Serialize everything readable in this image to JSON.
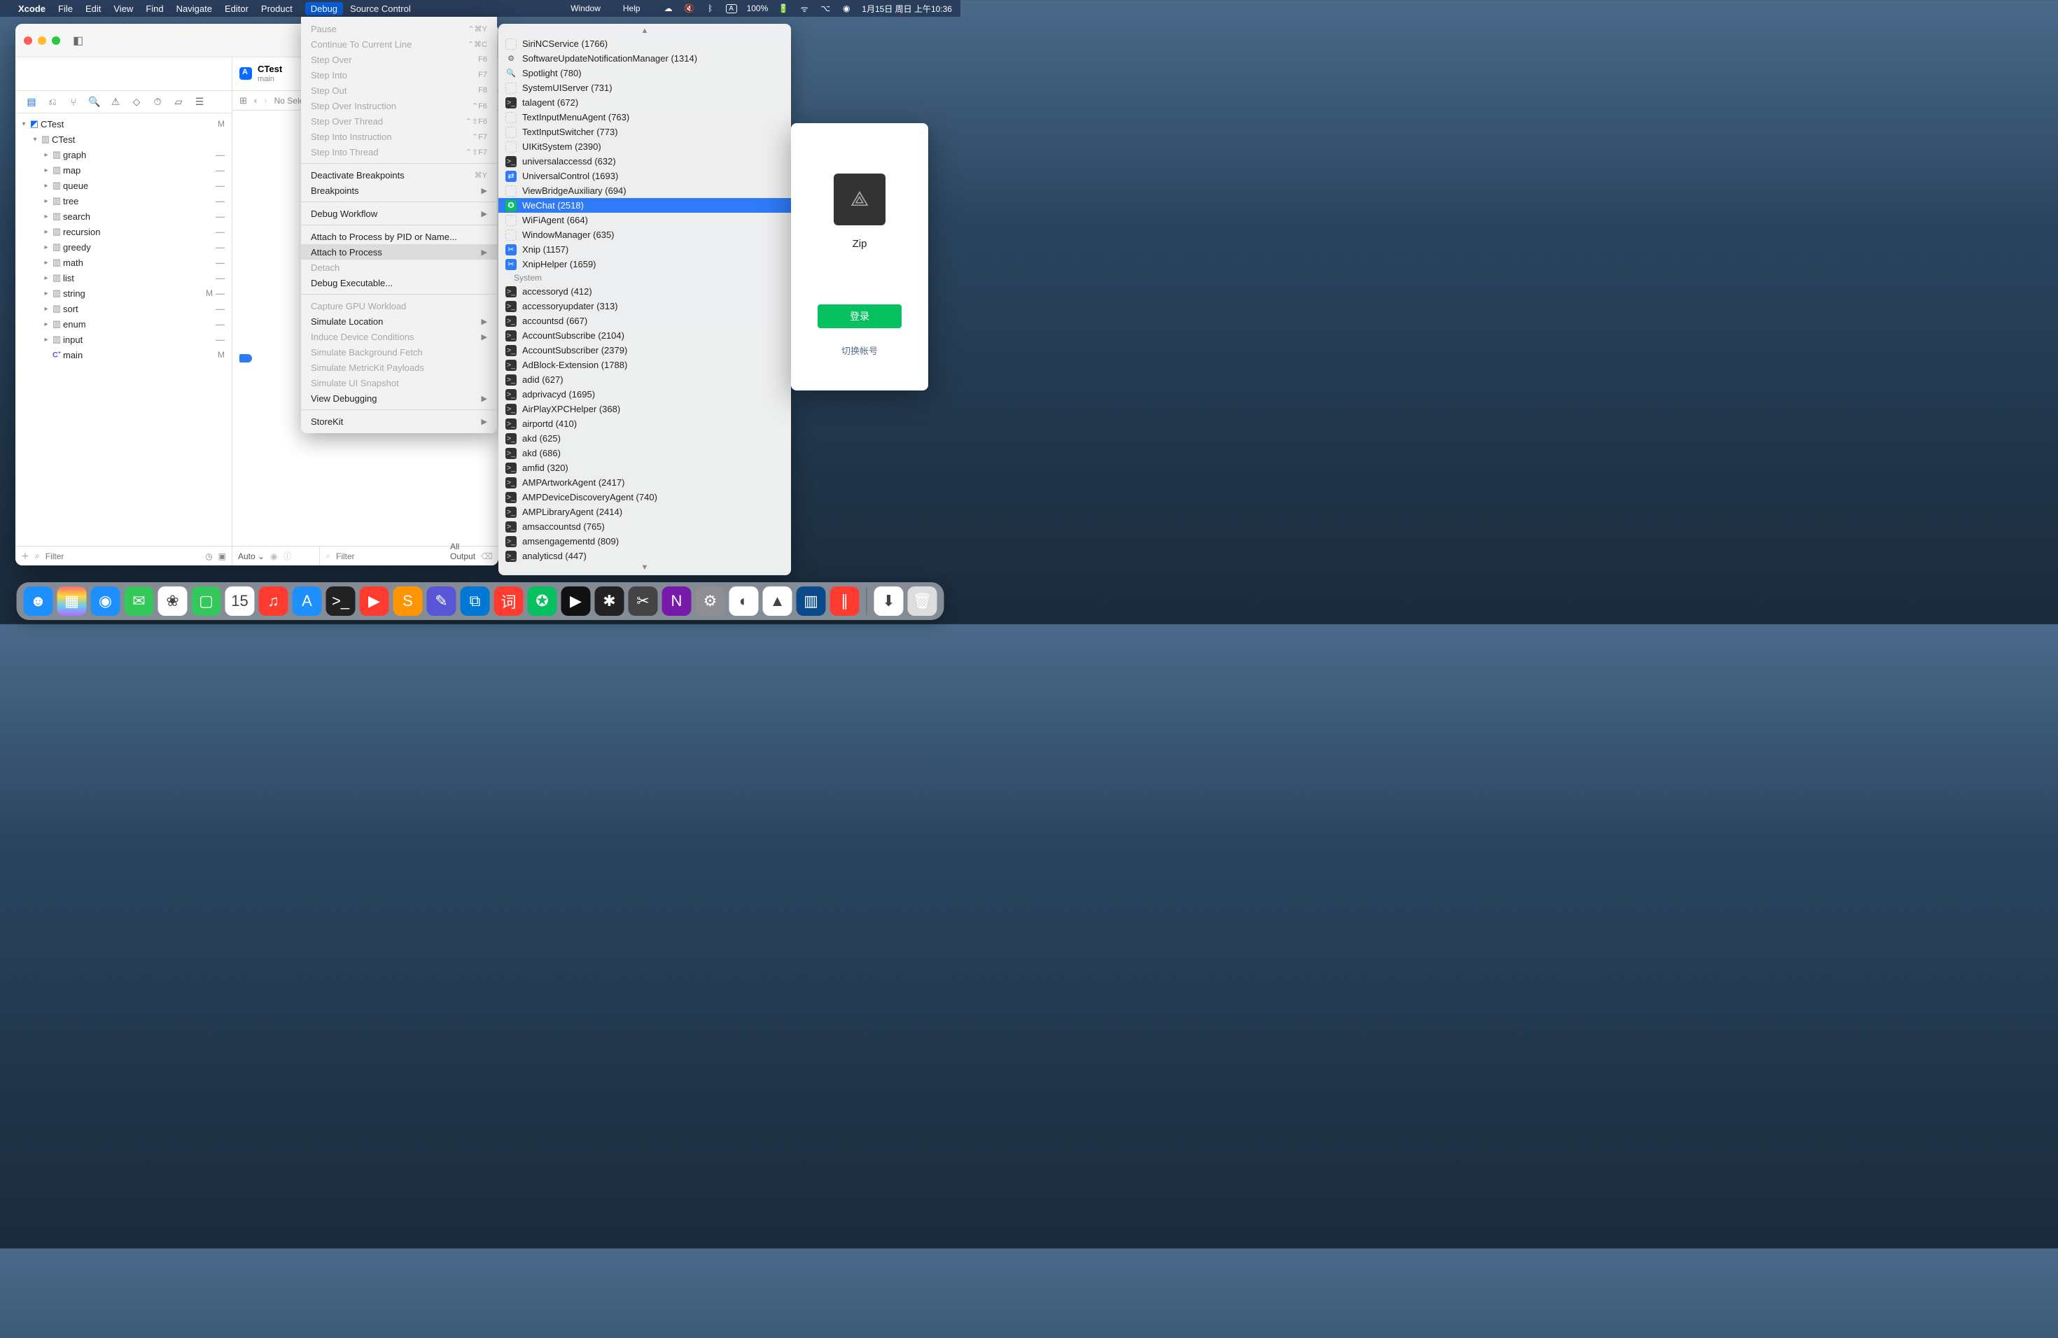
{
  "menubar": {
    "app": "Xcode",
    "items": [
      "File",
      "Edit",
      "View",
      "Find",
      "Navigate",
      "Editor",
      "Product",
      "Debug",
      "Source Control"
    ],
    "right_items": [
      "Window",
      "Help"
    ],
    "battery": "100%",
    "input_indicator": "A",
    "datetime": "1月15日 周日 上午10:36"
  },
  "scheme": {
    "name": "CTest",
    "target": "main"
  },
  "navigator": {
    "filter_placeholder": "Filter",
    "tree": [
      {
        "indent": 0,
        "icon": "app",
        "label": "CTest",
        "badge": "M",
        "open": true
      },
      {
        "indent": 1,
        "icon": "folder",
        "label": "CTest",
        "open": true
      },
      {
        "indent": 2,
        "icon": "folder",
        "label": "graph",
        "closed": true,
        "dash": true
      },
      {
        "indent": 2,
        "icon": "folder",
        "label": "map",
        "closed": true,
        "dash": true
      },
      {
        "indent": 2,
        "icon": "folder",
        "label": "queue",
        "closed": true,
        "dash": true
      },
      {
        "indent": 2,
        "icon": "folder",
        "label": "tree",
        "closed": true,
        "dash": true
      },
      {
        "indent": 2,
        "icon": "folder",
        "label": "search",
        "closed": true,
        "dash": true
      },
      {
        "indent": 2,
        "icon": "folder",
        "label": "recursion",
        "closed": true,
        "dash": true
      },
      {
        "indent": 2,
        "icon": "folder",
        "label": "greedy",
        "closed": true,
        "dash": true
      },
      {
        "indent": 2,
        "icon": "folder",
        "label": "math",
        "closed": true,
        "dash": true
      },
      {
        "indent": 2,
        "icon": "folder",
        "label": "list",
        "closed": true,
        "dash": true
      },
      {
        "indent": 2,
        "icon": "folder",
        "label": "string",
        "closed": true,
        "badge": "M",
        "dash": true
      },
      {
        "indent": 2,
        "icon": "folder",
        "label": "sort",
        "closed": true,
        "dash": true
      },
      {
        "indent": 2,
        "icon": "folder",
        "label": "enum",
        "closed": true,
        "dash": true
      },
      {
        "indent": 2,
        "icon": "folder",
        "label": "input",
        "closed": true,
        "dash": true
      },
      {
        "indent": 2,
        "icon": "c",
        "label": "main",
        "badge": "M"
      }
    ]
  },
  "jump_bar": {
    "no_selection": "No Selection"
  },
  "debug_area": {
    "auto_label": "Auto",
    "filter_placeholder": "Filter",
    "all_output_label": "All Output"
  },
  "debug_menu": [
    {
      "label": "Pause",
      "shortcut": "⌃⌘Y",
      "disabled": true
    },
    {
      "label": "Continue To Current Line",
      "shortcut": "⌃⌘C",
      "disabled": true
    },
    {
      "label": "Step Over",
      "shortcut": "F6",
      "disabled": true
    },
    {
      "label": "Step Into",
      "shortcut": "F7",
      "disabled": true
    },
    {
      "label": "Step Out",
      "shortcut": "F8",
      "disabled": true
    },
    {
      "label": "Step Over Instruction",
      "shortcut": "⌃F6",
      "disabled": true
    },
    {
      "label": "Step Over Thread",
      "shortcut": "⌃⇧F6",
      "disabled": true
    },
    {
      "label": "Step Into Instruction",
      "shortcut": "⌃F7",
      "disabled": true
    },
    {
      "label": "Step Into Thread",
      "shortcut": "⌃⇧F7",
      "disabled": true
    },
    {
      "separator": true
    },
    {
      "label": "Deactivate Breakpoints",
      "shortcut": "⌘Y"
    },
    {
      "label": "Breakpoints",
      "submenu": true
    },
    {
      "separator": true
    },
    {
      "label": "Debug Workflow",
      "submenu": true
    },
    {
      "separator": true
    },
    {
      "label": "Attach to Process by PID or Name..."
    },
    {
      "label": "Attach to Process",
      "submenu": true,
      "highlight": true
    },
    {
      "label": "Detach",
      "disabled": true
    },
    {
      "label": "Debug Executable..."
    },
    {
      "separator": true
    },
    {
      "label": "Capture GPU Workload",
      "disabled": true
    },
    {
      "label": "Simulate Location",
      "submenu": true
    },
    {
      "label": "Induce Device Conditions",
      "submenu": true,
      "disabled": true
    },
    {
      "label": "Simulate Background Fetch",
      "disabled": true
    },
    {
      "label": "Simulate MetricKit Payloads",
      "disabled": true
    },
    {
      "label": "Simulate UI Snapshot",
      "disabled": true
    },
    {
      "label": "View Debugging",
      "submenu": true
    },
    {
      "separator": true
    },
    {
      "label": "StoreKit",
      "submenu": true
    }
  ],
  "process_menu": {
    "section_label": "System",
    "items_top": [
      {
        "icon": "blank",
        "label": "SiriNCService (1766)"
      },
      {
        "icon": "gear",
        "label": "SoftwareUpdateNotificationManager (1314)"
      },
      {
        "icon": "search",
        "label": "Spotlight (780)"
      },
      {
        "icon": "blank",
        "label": "SystemUIServer (731)"
      },
      {
        "icon": "term",
        "label": "talagent (672)"
      },
      {
        "icon": "blank",
        "label": "TextInputMenuAgent (763)"
      },
      {
        "icon": "blank",
        "label": "TextInputSwitcher (773)"
      },
      {
        "icon": "blank",
        "label": "UIKitSystem (2390)"
      },
      {
        "icon": "term",
        "label": "universalaccessd (632)"
      },
      {
        "icon": "blue",
        "label": "UniversalControl (1693)"
      },
      {
        "icon": "blank",
        "label": "ViewBridgeAuxiliary (694)"
      },
      {
        "icon": "wechat",
        "label": "WeChat (2518)",
        "selected": true
      },
      {
        "icon": "blank",
        "label": "WiFiAgent (664)"
      },
      {
        "icon": "blank",
        "label": "WindowManager (635)"
      },
      {
        "icon": "xnip",
        "label": "Xnip (1157)"
      },
      {
        "icon": "xnip",
        "label": "XnipHelper (1659)"
      }
    ],
    "items_system": [
      {
        "icon": "term",
        "label": "accessoryd (412)"
      },
      {
        "icon": "term",
        "label": "accessoryupdater (313)"
      },
      {
        "icon": "term",
        "label": "accountsd (667)"
      },
      {
        "icon": "term",
        "label": "AccountSubscribe (2104)"
      },
      {
        "icon": "term",
        "label": "AccountSubscriber (2379)"
      },
      {
        "icon": "term",
        "label": "AdBlock-Extension (1788)"
      },
      {
        "icon": "term",
        "label": "adid (627)"
      },
      {
        "icon": "term",
        "label": "adprivacyd (1695)"
      },
      {
        "icon": "term",
        "label": "AirPlayXPCHelper (368)"
      },
      {
        "icon": "term",
        "label": "airportd (410)"
      },
      {
        "icon": "term",
        "label": "akd (625)"
      },
      {
        "icon": "term",
        "label": "akd (686)"
      },
      {
        "icon": "term",
        "label": "amfid (320)"
      },
      {
        "icon": "term",
        "label": "AMPArtworkAgent (2417)"
      },
      {
        "icon": "term",
        "label": "AMPDeviceDiscoveryAgent (740)"
      },
      {
        "icon": "term",
        "label": "AMPLibraryAgent (2414)"
      },
      {
        "icon": "term",
        "label": "amsaccountsd (765)"
      },
      {
        "icon": "term",
        "label": "amsengagementd (809)"
      },
      {
        "icon": "term",
        "label": "analyticsd (447)"
      }
    ]
  },
  "wechat": {
    "username": "Zip",
    "login_label": "登录",
    "switch_label": "切换帐号"
  },
  "dock": [
    {
      "name": "finder",
      "bg": "#1e8fff",
      "glyph": "☻"
    },
    {
      "name": "launchpad",
      "bg": "linear-gradient(#ff6b6b,#ffd93d,#6bcBef,#b06bff)",
      "glyph": "▦"
    },
    {
      "name": "safari",
      "bg": "#1e8fff",
      "glyph": "◉"
    },
    {
      "name": "messages",
      "bg": "#34c759",
      "glyph": "✉"
    },
    {
      "name": "photos",
      "bg": "#fff",
      "glyph": "❀"
    },
    {
      "name": "facetime",
      "bg": "#34c759",
      "glyph": "▢"
    },
    {
      "name": "calendar",
      "bg": "#fff",
      "glyph": "15"
    },
    {
      "name": "music",
      "bg": "#ff3b30",
      "glyph": "♫"
    },
    {
      "name": "appstore",
      "bg": "#1e8fff",
      "glyph": "A"
    },
    {
      "name": "terminal",
      "bg": "#222",
      "glyph": ">_"
    },
    {
      "name": "pdf",
      "bg": "#ff3b30",
      "glyph": "▶"
    },
    {
      "name": "sublime",
      "bg": "#ff9500",
      "glyph": "S"
    },
    {
      "name": "tool1",
      "bg": "#5856d6",
      "glyph": "✎"
    },
    {
      "name": "vscode",
      "bg": "#0078d4",
      "glyph": "⧉"
    },
    {
      "name": "dict",
      "bg": "#ff3b30",
      "glyph": "词"
    },
    {
      "name": "wechat",
      "bg": "#07c160",
      "glyph": "✪"
    },
    {
      "name": "player",
      "bg": "#111",
      "glyph": "▶"
    },
    {
      "name": "figma",
      "bg": "#222",
      "glyph": "✱"
    },
    {
      "name": "fcp",
      "bg": "#444",
      "glyph": "✂"
    },
    {
      "name": "onenote",
      "bg": "#7719aa",
      "glyph": "N"
    },
    {
      "name": "settings",
      "bg": "#8e8e93",
      "glyph": "⚙"
    },
    {
      "name": "chrome",
      "bg": "#fff",
      "glyph": "◐"
    },
    {
      "name": "cleanmymac",
      "bg": "#fff",
      "glyph": "▲"
    },
    {
      "name": "monitor",
      "bg": "#0a4a8a",
      "glyph": "▥"
    },
    {
      "name": "parallels",
      "bg": "#ff3b30",
      "glyph": "∥"
    },
    {
      "name": "downloads",
      "bg": "#fff",
      "glyph": "⬇"
    },
    {
      "name": "trash",
      "bg": "#ddd",
      "glyph": "🗑"
    }
  ]
}
